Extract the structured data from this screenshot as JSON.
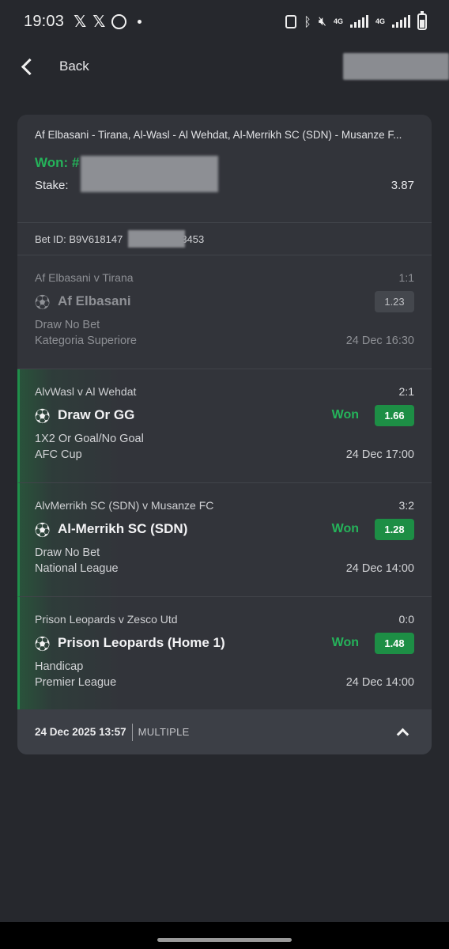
{
  "status_bar": {
    "time": "19:03",
    "net_label_1": "4G",
    "net_label_2": "4G",
    "icons": [
      "x-icon",
      "x-icon",
      "whatsapp-icon",
      "dot-icon",
      "clipboard-icon",
      "bluetooth-icon",
      "mute-icon",
      "signal-icon",
      "signal-icon",
      "battery-icon"
    ]
  },
  "header": {
    "back_label": "Back"
  },
  "summary": {
    "title": "Af Elbasani - Tirana, Al-Wasl - Al Wehdat, Al-Merrikh SC (SDN) - Musanze F...",
    "won_label": "Won: #",
    "stake_label": "Stake: ",
    "total_odds": "3.87"
  },
  "bet_id": {
    "prefix": "Bet ID: B9V618147",
    "suffix": "3453"
  },
  "selections": [
    {
      "match": "Af Elbasani v Tirana",
      "score": "1:1",
      "pick": "Af Elbasani",
      "status": "",
      "odds": "1.23",
      "market": "Draw No Bet",
      "league": "Kategoria Superiore",
      "date": "24 Dec 16:30"
    },
    {
      "match": "AlvWasl v Al Wehdat",
      "score": "2:1",
      "pick": "Draw Or GG",
      "status": "Won",
      "odds": "1.66",
      "market": "1X2 Or Goal/No Goal",
      "league": "AFC Cup",
      "date": "24 Dec 17:00"
    },
    {
      "match": "AlvMerrikh SC (SDN) v Musanze FC",
      "score": "3:2",
      "pick": "Al-Merrikh SC (SDN)",
      "status": "Won",
      "odds": "1.28",
      "market": "Draw No Bet",
      "league": "National League",
      "date": "24 Dec 14:00"
    },
    {
      "match": "Prison Leopards v Zesco Utd",
      "score": "0:0",
      "pick": "Prison Leopards (Home 1)",
      "status": "Won",
      "odds": "1.48",
      "market": "Handicap",
      "league": "Premier League",
      "date": "24 Dec 14:00"
    }
  ],
  "footer": {
    "placed_date": "24 Dec 2025 13:57",
    "bet_type": "MULTIPLE"
  },
  "colors": {
    "background": "#26282d",
    "card": "#32343a",
    "won_green": "#25b35a",
    "odds_green": "#1d8e45"
  }
}
